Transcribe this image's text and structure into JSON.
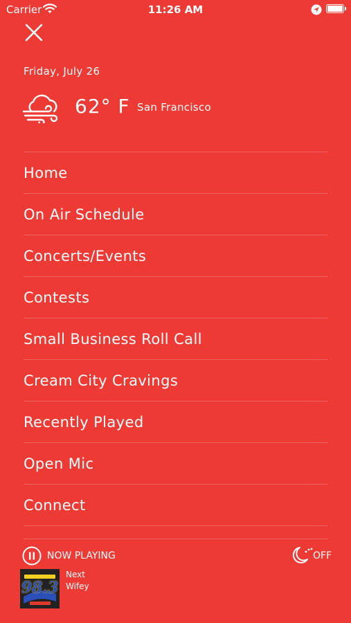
{
  "status_bar": {
    "carrier": "Carrier",
    "time": "11:26 AM",
    "icons": [
      "wifi-icon",
      "location-arrow-icon",
      "battery-icon"
    ],
    "battery_level_percent": 100
  },
  "drawer": {
    "close_icon": "close-icon",
    "date": "Friday, July 26",
    "weather": {
      "icon": "cloudy-windy-icon",
      "temperature": "62° F",
      "city": "San Francisco"
    },
    "menu_items": [
      {
        "label": "Home"
      },
      {
        "label": "On Air Schedule"
      },
      {
        "label": "Concerts/Events"
      },
      {
        "label": "Contests"
      },
      {
        "label": "Small Business Roll Call"
      },
      {
        "label": "Cream City Cravings"
      },
      {
        "label": "Recently Played"
      },
      {
        "label": "Open Mic"
      },
      {
        "label": "Connect"
      }
    ]
  },
  "player": {
    "pause_icon": "pause-icon",
    "now_playing_label": "NOW PLAYING",
    "sleep_icon": "sleep-timer-icon",
    "sleep_timer_label": "OFF",
    "artwork_logo_text": "98.3",
    "track_title": "Next",
    "track_artist": "Wifey"
  },
  "colors": {
    "background": "#ee3a35",
    "foreground": "#ffffff",
    "logo_blue": "#2a4fb8",
    "logo_yellow": "#f5cf1f"
  }
}
